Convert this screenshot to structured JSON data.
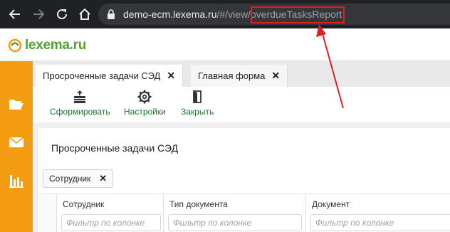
{
  "browser": {
    "url_host": "demo-ecm.lexema.ru",
    "url_path": "/#/view/",
    "url_highlight": "overdueTasksReport"
  },
  "app": {
    "logo_text": "lexema.ru",
    "brand_color": "#55a232",
    "sidebar_color": "#f39c12",
    "accent_color": "#1a7a2e"
  },
  "sidebar": {
    "items": [
      {
        "icon": "folder-open-icon"
      },
      {
        "icon": "envelope-icon"
      },
      {
        "icon": "bar-chart-icon"
      }
    ]
  },
  "tabs": [
    {
      "label": "Просроченные задачи СЭД",
      "active": true
    },
    {
      "label": "Главная форма",
      "active": false
    }
  ],
  "toolbar": {
    "generate_label": "Сформировать",
    "settings_label": "Настройки",
    "close_label": "Закрыть"
  },
  "report": {
    "title": "Просроченные задачи СЭД",
    "group_chip": "Сотрудник"
  },
  "grid": {
    "columns": [
      {
        "header": "Сотрудник",
        "filter_placeholder": "Фильтр по колонке"
      },
      {
        "header": "Тип документа",
        "filter_placeholder": "Фильтр по колонке"
      },
      {
        "header": "Документ",
        "filter_placeholder": "Фильтр по колонке"
      }
    ]
  }
}
